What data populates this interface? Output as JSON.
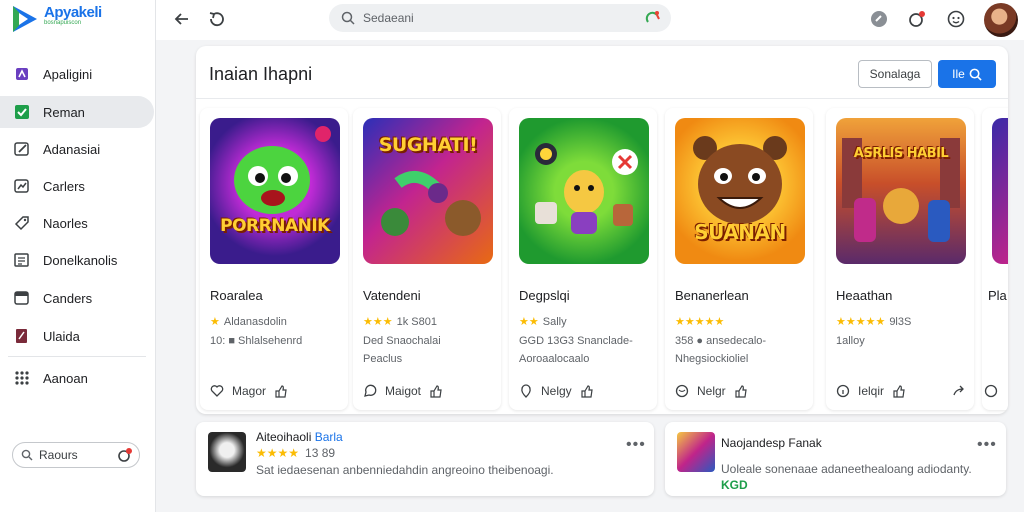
{
  "app": {
    "name": "Apyakeli",
    "tagline": "bosnapuiscon",
    "brand_color": "#1a73e8"
  },
  "sidebar": {
    "items": [
      {
        "label": "Apaligini",
        "icon": "apps-icon",
        "color": "#6a3fc0",
        "active": false
      },
      {
        "label": "Reman",
        "icon": "check-icon",
        "color": "#1e9e4a",
        "active": true
      },
      {
        "label": "Adanasiai",
        "icon": "edit-icon",
        "color": "#3c4043",
        "active": false
      },
      {
        "label": "Carlers",
        "icon": "chart-icon",
        "color": "#3c4043",
        "active": false
      },
      {
        "label": "Naorles",
        "icon": "tag-icon",
        "color": "#3c4043",
        "active": false
      },
      {
        "label": "Donelkanolis",
        "icon": "list-icon",
        "color": "#3c4043",
        "active": false
      },
      {
        "label": "Canders",
        "icon": "calendar-icon",
        "color": "#3c4043",
        "active": false
      },
      {
        "label": "Ulaida",
        "icon": "book-icon",
        "color": "#7a2a3a",
        "active": false
      },
      {
        "label": "Aanoan",
        "icon": "grid-icon",
        "color": "#3c4043",
        "active": false
      }
    ],
    "search_placeholder": "Raours"
  },
  "topbar": {
    "search_placeholder": "Sedaeani"
  },
  "panel": {
    "title": "Inaian Ihapni",
    "secondary_button": "Sonalaga",
    "primary_button": "Ile"
  },
  "cards": [
    {
      "thumb_text": "PORRNANIK",
      "title": "Roaralea",
      "stars": "★",
      "rating": "Aldanasdolin",
      "line1": "10: ■ Shlalsehenrd",
      "line2": "",
      "action": "Magor"
    },
    {
      "thumb_text": "SUGHATI!",
      "title": "Vatendeni",
      "stars": "★★★",
      "rating": "1k S801",
      "line1": "Ded Snaochalai",
      "line2": "Peaclus",
      "action": "Maigot"
    },
    {
      "thumb_text": "",
      "title": "Degpslqi",
      "stars": "★★",
      "rating": "Sally",
      "line1": "GGD 13G3 Snanclade-",
      "line2": "Aoroaalocaalo",
      "action": "Nelgy"
    },
    {
      "thumb_text": "SUANAN",
      "title": "Benanerlean",
      "stars": "★★★★★",
      "rating": "",
      "line1": "358 ● ansedecalo-",
      "line2": "Nhegsiockioliel",
      "action": "Nelgr"
    },
    {
      "thumb_text": "ASRLIS HABIL",
      "title": "Heaathan",
      "stars": "★★★★★",
      "rating": "9l3S",
      "line1": "1alloy",
      "line2": "",
      "action": "Ielqir"
    },
    {
      "thumb_text": "",
      "title": "Pla",
      "stars": "",
      "rating": "",
      "line1": "",
      "line2": "",
      "action": ""
    }
  ],
  "rows": [
    {
      "title": "Aiteoihaoli",
      "title_accent": "Barla",
      "stars": "★★★★",
      "rating": "13 89",
      "sub": "Sat iedaesenan anbenniedahdin angreoino theibenoagi."
    },
    {
      "title": "Naojandesp Fanak",
      "title_accent": "",
      "stars": "",
      "rating": "",
      "sub": "Uoleale sonenaae adaneethealoang adiodanty.",
      "badge": "KGD"
    }
  ]
}
